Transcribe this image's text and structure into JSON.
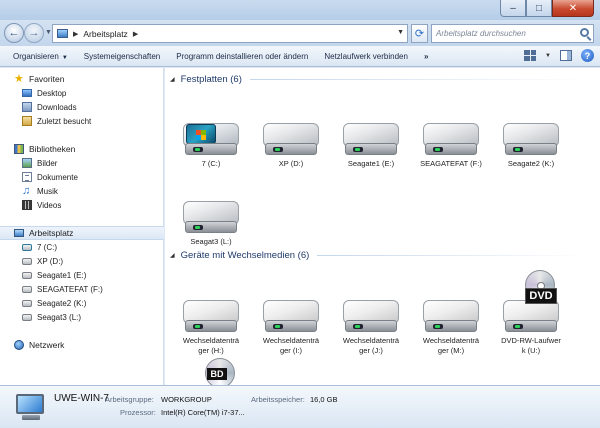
{
  "address": {
    "crumb": "Arbeitsplatz",
    "search_placeholder": "Arbeitsplatz durchsuchen"
  },
  "toolbar": {
    "organize": "Organisieren",
    "system_properties": "Systemeigenschaften",
    "uninstall": "Programm deinstallieren oder ändern",
    "map_drive": "Netzlaufwerk verbinden",
    "more": "»"
  },
  "sidebar": {
    "favorites": {
      "label": "Favoriten",
      "items": [
        "Desktop",
        "Downloads",
        "Zuletzt besucht"
      ]
    },
    "libraries": {
      "label": "Bibliotheken",
      "items": [
        "Bilder",
        "Dokumente",
        "Musik",
        "Videos"
      ]
    },
    "computer": {
      "label": "Arbeitsplatz",
      "items": [
        "7 (C:)",
        "XP (D:)",
        "Seagate1 (E:)",
        "SEAGATEFAT (F:)",
        "Seagate2 (K:)",
        "Seagat3 (L:)"
      ]
    },
    "network": {
      "label": "Netzwerk"
    }
  },
  "main": {
    "hdd_group": "Festplatten (6)",
    "drives": [
      "7 (C:)",
      "XP (D:)",
      "Seagate1 (E:)",
      "SEAGATEFAT (F:)",
      "Seagate2 (K:)",
      "Seagat3 (L:)"
    ],
    "removable_group": "Geräte mit Wechselmedien (6)",
    "removable": [
      {
        "line1": "Wechseldatenträ",
        "line2": "ger (H:)"
      },
      {
        "line1": "Wechseldatenträ",
        "line2": "ger (I:)"
      },
      {
        "line1": "Wechseldatenträ",
        "line2": "ger (J:)"
      },
      {
        "line1": "Wechseldatenträ",
        "line2": "ger (M:)"
      },
      {
        "line1": "DVD-RW-Laufwer",
        "line2": "k (U:)"
      }
    ],
    "dvd_badge": "DVD",
    "bd_badge": "BD"
  },
  "details": {
    "computer_name": "UWE-WIN-7",
    "workgroup_label": "Arbeitsgruppe:",
    "workgroup_value": "WORKGROUP",
    "memory_label": "Arbeitsspeicher:",
    "memory_value": "16,0 GB",
    "processor_label": "Prozessor:",
    "processor_value": "Intel(R) Core(TM) i7-37..."
  }
}
